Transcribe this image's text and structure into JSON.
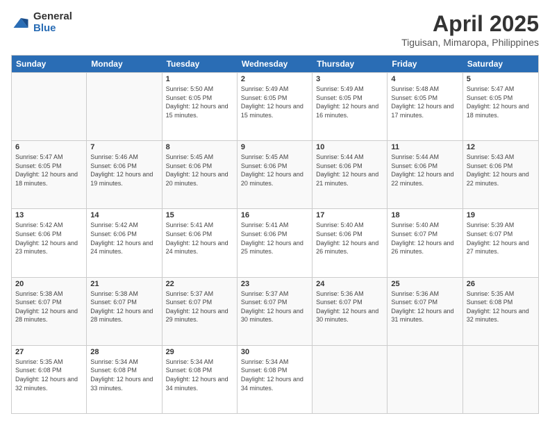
{
  "header": {
    "logo_general": "General",
    "logo_blue": "Blue",
    "title": "April 2025",
    "location": "Tiguisan, Mimaropa, Philippines"
  },
  "calendar": {
    "days_of_week": [
      "Sunday",
      "Monday",
      "Tuesday",
      "Wednesday",
      "Thursday",
      "Friday",
      "Saturday"
    ],
    "weeks": [
      {
        "cells": [
          {
            "day": null
          },
          {
            "day": null
          },
          {
            "day": "1",
            "sunrise": "Sunrise: 5:50 AM",
            "sunset": "Sunset: 6:05 PM",
            "daylight": "Daylight: 12 hours and 15 minutes."
          },
          {
            "day": "2",
            "sunrise": "Sunrise: 5:49 AM",
            "sunset": "Sunset: 6:05 PM",
            "daylight": "Daylight: 12 hours and 15 minutes."
          },
          {
            "day": "3",
            "sunrise": "Sunrise: 5:49 AM",
            "sunset": "Sunset: 6:05 PM",
            "daylight": "Daylight: 12 hours and 16 minutes."
          },
          {
            "day": "4",
            "sunrise": "Sunrise: 5:48 AM",
            "sunset": "Sunset: 6:05 PM",
            "daylight": "Daylight: 12 hours and 17 minutes."
          },
          {
            "day": "5",
            "sunrise": "Sunrise: 5:47 AM",
            "sunset": "Sunset: 6:05 PM",
            "daylight": "Daylight: 12 hours and 18 minutes."
          }
        ]
      },
      {
        "cells": [
          {
            "day": "6",
            "sunrise": "Sunrise: 5:47 AM",
            "sunset": "Sunset: 6:05 PM",
            "daylight": "Daylight: 12 hours and 18 minutes."
          },
          {
            "day": "7",
            "sunrise": "Sunrise: 5:46 AM",
            "sunset": "Sunset: 6:06 PM",
            "daylight": "Daylight: 12 hours and 19 minutes."
          },
          {
            "day": "8",
            "sunrise": "Sunrise: 5:45 AM",
            "sunset": "Sunset: 6:06 PM",
            "daylight": "Daylight: 12 hours and 20 minutes."
          },
          {
            "day": "9",
            "sunrise": "Sunrise: 5:45 AM",
            "sunset": "Sunset: 6:06 PM",
            "daylight": "Daylight: 12 hours and 20 minutes."
          },
          {
            "day": "10",
            "sunrise": "Sunrise: 5:44 AM",
            "sunset": "Sunset: 6:06 PM",
            "daylight": "Daylight: 12 hours and 21 minutes."
          },
          {
            "day": "11",
            "sunrise": "Sunrise: 5:44 AM",
            "sunset": "Sunset: 6:06 PM",
            "daylight": "Daylight: 12 hours and 22 minutes."
          },
          {
            "day": "12",
            "sunrise": "Sunrise: 5:43 AM",
            "sunset": "Sunset: 6:06 PM",
            "daylight": "Daylight: 12 hours and 22 minutes."
          }
        ]
      },
      {
        "cells": [
          {
            "day": "13",
            "sunrise": "Sunrise: 5:42 AM",
            "sunset": "Sunset: 6:06 PM",
            "daylight": "Daylight: 12 hours and 23 minutes."
          },
          {
            "day": "14",
            "sunrise": "Sunrise: 5:42 AM",
            "sunset": "Sunset: 6:06 PM",
            "daylight": "Daylight: 12 hours and 24 minutes."
          },
          {
            "day": "15",
            "sunrise": "Sunrise: 5:41 AM",
            "sunset": "Sunset: 6:06 PM",
            "daylight": "Daylight: 12 hours and 24 minutes."
          },
          {
            "day": "16",
            "sunrise": "Sunrise: 5:41 AM",
            "sunset": "Sunset: 6:06 PM",
            "daylight": "Daylight: 12 hours and 25 minutes."
          },
          {
            "day": "17",
            "sunrise": "Sunrise: 5:40 AM",
            "sunset": "Sunset: 6:06 PM",
            "daylight": "Daylight: 12 hours and 26 minutes."
          },
          {
            "day": "18",
            "sunrise": "Sunrise: 5:40 AM",
            "sunset": "Sunset: 6:07 PM",
            "daylight": "Daylight: 12 hours and 26 minutes."
          },
          {
            "day": "19",
            "sunrise": "Sunrise: 5:39 AM",
            "sunset": "Sunset: 6:07 PM",
            "daylight": "Daylight: 12 hours and 27 minutes."
          }
        ]
      },
      {
        "cells": [
          {
            "day": "20",
            "sunrise": "Sunrise: 5:38 AM",
            "sunset": "Sunset: 6:07 PM",
            "daylight": "Daylight: 12 hours and 28 minutes."
          },
          {
            "day": "21",
            "sunrise": "Sunrise: 5:38 AM",
            "sunset": "Sunset: 6:07 PM",
            "daylight": "Daylight: 12 hours and 28 minutes."
          },
          {
            "day": "22",
            "sunrise": "Sunrise: 5:37 AM",
            "sunset": "Sunset: 6:07 PM",
            "daylight": "Daylight: 12 hours and 29 minutes."
          },
          {
            "day": "23",
            "sunrise": "Sunrise: 5:37 AM",
            "sunset": "Sunset: 6:07 PM",
            "daylight": "Daylight: 12 hours and 30 minutes."
          },
          {
            "day": "24",
            "sunrise": "Sunrise: 5:36 AM",
            "sunset": "Sunset: 6:07 PM",
            "daylight": "Daylight: 12 hours and 30 minutes."
          },
          {
            "day": "25",
            "sunrise": "Sunrise: 5:36 AM",
            "sunset": "Sunset: 6:07 PM",
            "daylight": "Daylight: 12 hours and 31 minutes."
          },
          {
            "day": "26",
            "sunrise": "Sunrise: 5:35 AM",
            "sunset": "Sunset: 6:08 PM",
            "daylight": "Daylight: 12 hours and 32 minutes."
          }
        ]
      },
      {
        "cells": [
          {
            "day": "27",
            "sunrise": "Sunrise: 5:35 AM",
            "sunset": "Sunset: 6:08 PM",
            "daylight": "Daylight: 12 hours and 32 minutes."
          },
          {
            "day": "28",
            "sunrise": "Sunrise: 5:34 AM",
            "sunset": "Sunset: 6:08 PM",
            "daylight": "Daylight: 12 hours and 33 minutes."
          },
          {
            "day": "29",
            "sunrise": "Sunrise: 5:34 AM",
            "sunset": "Sunset: 6:08 PM",
            "daylight": "Daylight: 12 hours and 34 minutes."
          },
          {
            "day": "30",
            "sunrise": "Sunrise: 5:34 AM",
            "sunset": "Sunset: 6:08 PM",
            "daylight": "Daylight: 12 hours and 34 minutes."
          },
          {
            "day": null
          },
          {
            "day": null
          },
          {
            "day": null
          }
        ]
      }
    ]
  }
}
